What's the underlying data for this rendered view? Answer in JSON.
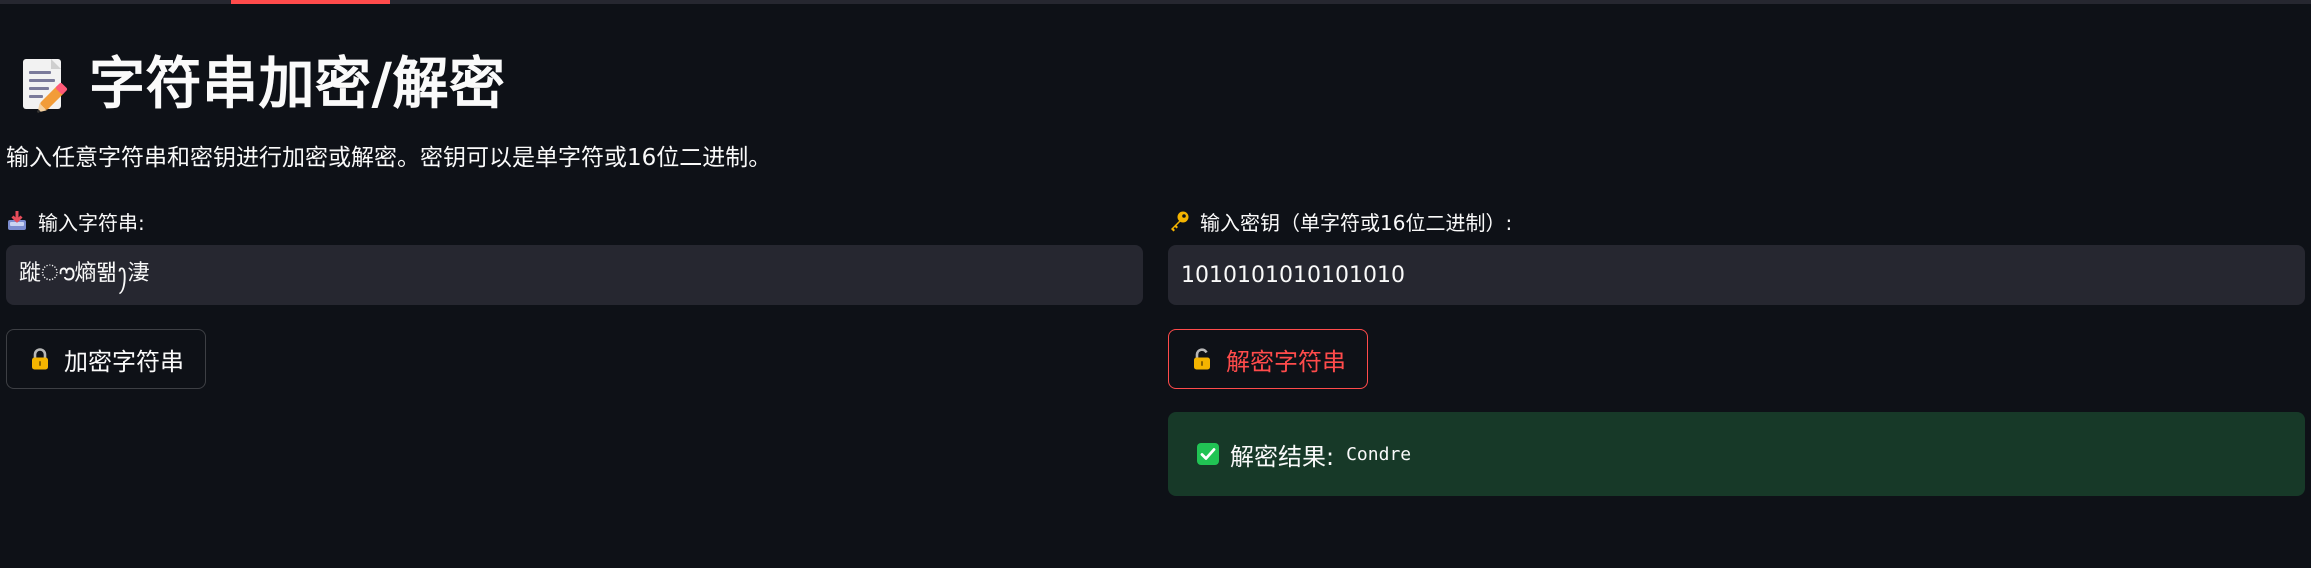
{
  "header": {
    "title": "字符串加密/解密",
    "title_icon": "memo-icon",
    "subtitle": "输入任意字符串和密钥进行加密或解密。密钥可以是单字符或16位二进制。"
  },
  "left": {
    "label": "输入字符串:",
    "label_icon": "inbox-tray-icon",
    "input_value": "蹝ൗ熵뙒ꫂ淒",
    "button_label": "加密字符串",
    "button_icon": "lock-icon"
  },
  "right": {
    "label": "输入密钥（单字符或16位二进制）:",
    "label_icon": "key-icon",
    "input_value": "1010101010101010",
    "button_label": "解密字符串",
    "button_icon": "unlock-icon"
  },
  "result": {
    "label": "解密结果:",
    "value": "Condre",
    "icon": "check-icon"
  },
  "colors": {
    "background": "#0e1117",
    "input_bg": "#262730",
    "accent": "#ff4b4b",
    "success_bg": "#173928",
    "success_icon": "#21c354"
  }
}
